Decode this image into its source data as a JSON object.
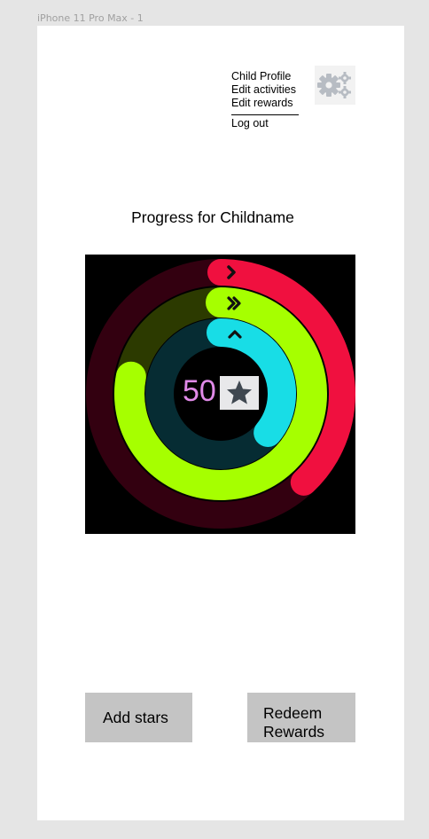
{
  "frame": {
    "label": "iPhone 11 Pro Max - 1"
  },
  "menu": {
    "items": [
      {
        "label": "Child Profile"
      },
      {
        "label": "Edit activities"
      },
      {
        "label": "Edit rewards"
      }
    ],
    "logout_label": "Log out",
    "settings_icon": "gear-icon"
  },
  "page": {
    "title": "Progress for Childname"
  },
  "progress": {
    "star_count": "50",
    "star_icon": "star-icon",
    "rings": [
      {
        "name": "outer",
        "color": "#f0103f",
        "track_color": "#330010",
        "fraction": 0.38,
        "icon": "chevron-right-icon"
      },
      {
        "name": "middle",
        "color": "#a6ff00",
        "track_color": "#2c3a00",
        "fraction": 0.78,
        "icon": "double-chevron-right-icon"
      },
      {
        "name": "inner",
        "color": "#18dde6",
        "track_color": "#062c33",
        "fraction": 0.36,
        "icon": "chevron-up-icon"
      }
    ]
  },
  "actions": {
    "add_stars_label": "Add stars",
    "redeem_line1": "Redeem",
    "redeem_line2": "Rewards"
  }
}
